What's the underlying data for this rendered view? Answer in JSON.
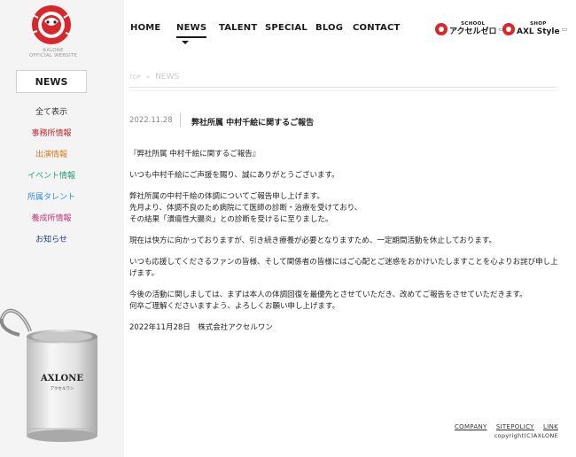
{
  "brand": {
    "subtitle_line1": "AXLONE",
    "subtitle_line2": "OFFICIAL WEBSITE",
    "can_label": "AXLONE",
    "can_sublabel": "アクセルワン"
  },
  "nav": {
    "items": [
      {
        "label": "HOME"
      },
      {
        "label": "NEWS"
      },
      {
        "label": "TALENT"
      },
      {
        "label": "SPECIAL"
      },
      {
        "label": "BLOG"
      },
      {
        "label": "CONTACT"
      }
    ],
    "school": {
      "small": "SCHOOL",
      "large": "アクセルゼロ"
    },
    "shop": {
      "small": "SHOP",
      "large": "AXL Style"
    }
  },
  "sidebar": {
    "title": "NEWS",
    "categories": [
      {
        "label": "全て表示",
        "color": "#333333"
      },
      {
        "label": "事務所情報",
        "color": "#c0252b"
      },
      {
        "label": "出演情報",
        "color": "#e07a1f"
      },
      {
        "label": "イベント情報",
        "color": "#2a9d6f"
      },
      {
        "label": "所属タレント",
        "color": "#2f8ed6"
      },
      {
        "label": "養成所情報",
        "color": "#c3327e"
      },
      {
        "label": "お知らせ",
        "color": "#1f3a8a"
      }
    ]
  },
  "breadcrumb": {
    "top": "TOP",
    "sep": "»",
    "current": "NEWS"
  },
  "post": {
    "date": "2022.11.28",
    "title": "弊社所属 中村千絵に関するご報告",
    "paragraphs": [
      "『弊社所属 中村千絵に関するご報告』",
      "いつも中村千絵にご声援を賜り、誠にありがとうございます。",
      "弊社所属の中村千絵の体調についてご報告申し上げます。",
      "先月より、体調不良のため病院にて医師の診断・治療を受けており、",
      "その結果「潰瘍性大腸炎」との診断を受けるに至りました。",
      "現在は快方に向かっておりますが、引き続き療養が必要となりますため、一定期間活動を休止しております。",
      "いつも応援してくださるファンの皆様、そして関係者の皆様にはご心配とご迷惑をおかけいたしますことを心よりお詫び申し上げます。",
      "今後の活動に関しましては、まずは本人の体調回復を最優先とさせていただき、改めてご報告をさせていただきます。",
      "何卒ご理解くださいますよう、よろしくお願い申し上げます。",
      "2022年11月28日　株式会社アクセルワン"
    ]
  },
  "footer": {
    "links": [
      "COMPANY",
      "SITEPOLICY",
      "LINK"
    ],
    "copyright": "copyright(C)AXLONE"
  },
  "colors": {
    "accent": "#d8262a",
    "text": "#222222",
    "sidebar_bg": "#f4f4f4"
  }
}
